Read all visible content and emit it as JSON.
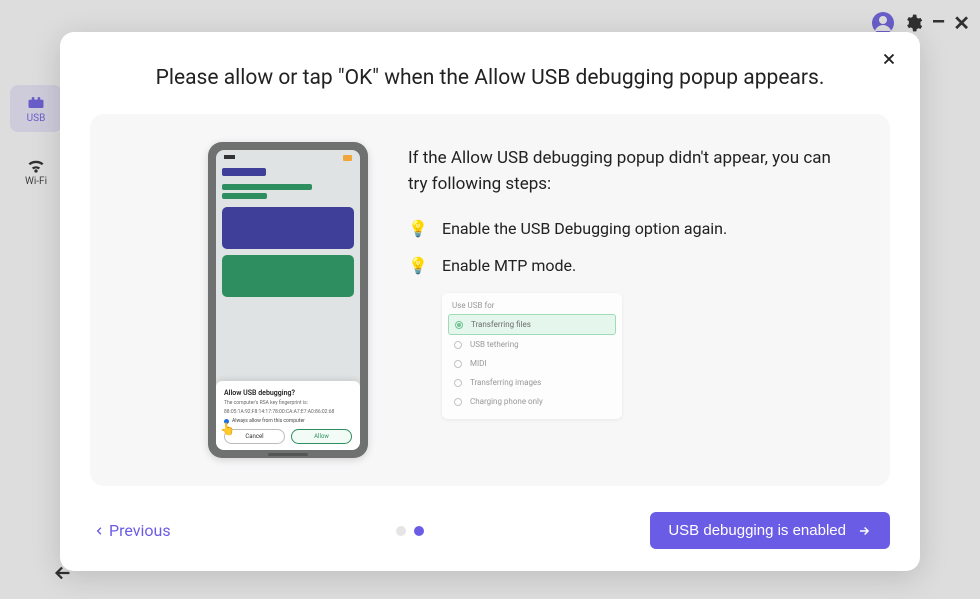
{
  "sidebar": {
    "item_usb": "USB",
    "item_wifi": "Wi-Fi"
  },
  "modal": {
    "title": "Please allow or tap \"OK\" when the Allow USB debugging popup appears.",
    "phone": {
      "dialog_title": "Allow USB debugging?",
      "dialog_text1": "The computer's RSA key fingerprint is:",
      "dialog_text2": "88:05:1A:92:F8:14:17:78:00:CA:A7:E7:A0:86:02:68",
      "always_label": "Always allow from this computer",
      "btn_cancel": "Cancel",
      "btn_allow": "Allow"
    },
    "desc": "If the Allow USB debugging popup didn't appear, you can try following steps:",
    "tip1": "Enable the USB Debugging option again.",
    "tip2": "Enable MTP mode.",
    "usb_header": "Use USB for",
    "usb_options": [
      "Transferring files",
      "USB tethering",
      "MIDI",
      "Transferring images",
      "Charging phone only"
    ],
    "prev": "Previous",
    "next": "USB debugging is enabled"
  }
}
